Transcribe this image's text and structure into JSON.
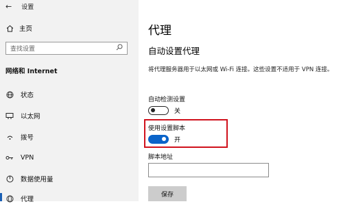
{
  "window": {
    "back_glyph": "←",
    "title": "设置"
  },
  "sidebar": {
    "home_label": "主页",
    "search_placeholder": "查找设置",
    "section_title": "网络和 Internet",
    "items": [
      {
        "icon": "globe-icon",
        "label": "状态"
      },
      {
        "icon": "ethernet-icon",
        "label": "以太网"
      },
      {
        "icon": "dialup-icon",
        "label": "拨号"
      },
      {
        "icon": "vpn-icon",
        "label": "VPN"
      },
      {
        "icon": "data-usage-icon",
        "label": "数据使用量"
      },
      {
        "icon": "proxy-globe-icon",
        "label": "代理"
      }
    ]
  },
  "main": {
    "title": "代理",
    "subtitle": "自动设置代理",
    "description": "将代理服务器用于以太网或 Wi-Fi 连接。这些设置不适用于 VPN 连接。",
    "auto_detect": {
      "label": "自动检测设置",
      "state": "关",
      "on": false
    },
    "use_script": {
      "label": "使用设置脚本",
      "state": "开",
      "on": true
    },
    "script_address": {
      "label": "脚本地址",
      "value": ""
    },
    "save_label": "保存"
  },
  "colors": {
    "accent": "#0a63c9",
    "highlight_box": "#d0101b",
    "sidebar_bg": "#f2f2f2"
  }
}
